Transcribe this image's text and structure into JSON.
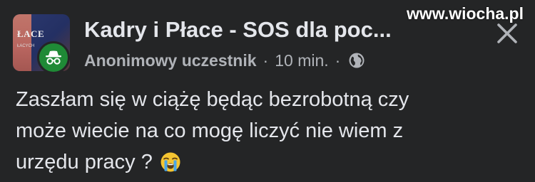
{
  "post": {
    "group_name": "Kadry i Płace - SOS dla poc...",
    "group_logo_text": "ŁACE",
    "group_logo_subtext": "ŁACYCH",
    "author": "Anonimowy uczestnik",
    "separator": "·",
    "time": "10 min.",
    "body_lines": [
      "Zaszłam się w ciążę będąc bezrobotną czy",
      "może wiecie na co mogę liczyć nie wiem z",
      "urzędu pracy ?"
    ],
    "emoji": "loudly-crying-face"
  },
  "icons": {
    "author_avatar": "incognito-icon",
    "privacy": "globe-icon",
    "close": "close-icon"
  },
  "watermark": "www.wiocha.pl",
  "colors": {
    "background": "#242526",
    "text_primary": "#e4e6eb",
    "text_secondary": "#b0b3b8",
    "avatar_green": "#1f8a36"
  }
}
